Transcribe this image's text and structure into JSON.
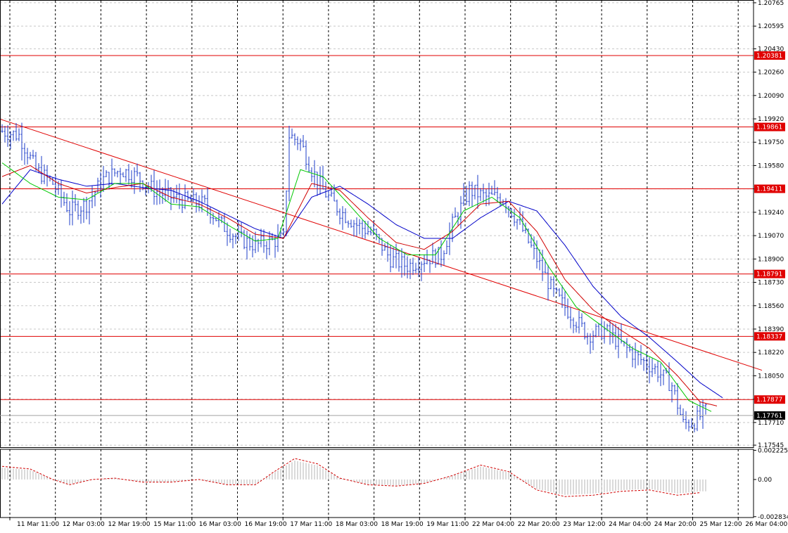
{
  "chart_data": {
    "type": "line",
    "symbol": "",
    "price_axis": {
      "ylim": [
        1.1753,
        1.2078
      ],
      "ticks": [
        "1.20765",
        "1.20595",
        "1.20430",
        "1.20260",
        "1.20090",
        "1.19920",
        "1.19750",
        "1.19580",
        "1.19410",
        "1.19240",
        "1.19070",
        "1.18900",
        "1.18730",
        "1.18560",
        "1.18390",
        "1.18220",
        "1.18050",
        "1.17880",
        "1.17710",
        "1.17545"
      ]
    },
    "oscillator_axis": {
      "ylim": [
        -0.0029,
        0.0023
      ],
      "ticks": [
        "0.002225",
        "0.00",
        "-0.002834"
      ]
    },
    "time_axis": {
      "labels": [
        "11 Mar 11:00",
        "12 Mar 03:00",
        "12 Mar 19:00",
        "15 Mar 11:00",
        "16 Mar 03:00",
        "16 Mar 19:00",
        "17 Mar 11:00",
        "18 Mar 03:00",
        "18 Mar 19:00",
        "19 Mar 11:00",
        "22 Mar 04:00",
        "22 Mar 20:00",
        "23 Mar 12:00",
        "24 Mar 04:00",
        "24 Mar 20:00",
        "25 Mar 12:00",
        "26 Mar 04:00"
      ]
    },
    "horizontal_levels": [
      {
        "label": "1.20381",
        "value": 1.20381,
        "color": "#e00000"
      },
      {
        "label": "1.19861",
        "value": 1.19861,
        "color": "#e00000"
      },
      {
        "label": "1.19411",
        "value": 1.19411,
        "color": "#e00000"
      },
      {
        "label": "1.18791",
        "value": 1.18791,
        "color": "#e00000"
      },
      {
        "label": "1.18337",
        "value": 1.18337,
        "color": "#e00000"
      },
      {
        "label": "1.17877",
        "value": 1.17877,
        "color": "#e00000"
      }
    ],
    "current_price": {
      "label": "1.17761",
      "value": 1.17761,
      "color": "#000000"
    },
    "trendline": {
      "from": [
        -4,
        1.1994
      ],
      "to": [
        270,
        1.1809
      ],
      "color": "#e00000"
    },
    "price_series": [
      [
        0,
        1.1983
      ],
      [
        6,
        1.198
      ],
      [
        12,
        1.1955
      ],
      [
        18,
        1.1945
      ],
      [
        24,
        1.1925
      ],
      [
        30,
        1.193
      ],
      [
        36,
        1.1948
      ],
      [
        42,
        1.1955
      ],
      [
        48,
        1.195
      ],
      [
        54,
        1.194
      ],
      [
        60,
        1.1935
      ],
      [
        66,
        1.1932
      ],
      [
        72,
        1.193
      ],
      [
        78,
        1.1915
      ],
      [
        84,
        1.1905
      ],
      [
        90,
        1.19
      ],
      [
        96,
        1.1903
      ],
      [
        100,
        1.1905
      ],
      [
        102,
        1.198
      ],
      [
        106,
        1.1975
      ],
      [
        110,
        1.1955
      ],
      [
        114,
        1.194
      ],
      [
        120,
        1.1925
      ],
      [
        126,
        1.1915
      ],
      [
        132,
        1.1908
      ],
      [
        138,
        1.189
      ],
      [
        144,
        1.1885
      ],
      [
        150,
        1.189
      ],
      [
        156,
        1.1893
      ],
      [
        160,
        1.1915
      ],
      [
        166,
        1.194
      ],
      [
        172,
        1.1935
      ],
      [
        178,
        1.1935
      ],
      [
        184,
        1.1915
      ],
      [
        190,
        1.189
      ],
      [
        196,
        1.1865
      ],
      [
        202,
        1.185
      ],
      [
        208,
        1.1835
      ],
      [
        214,
        1.1838
      ],
      [
        220,
        1.1828
      ],
      [
        226,
        1.1818
      ],
      [
        232,
        1.181
      ],
      [
        238,
        1.1798
      ],
      [
        242,
        1.177
      ],
      [
        246,
        1.1772
      ],
      [
        250,
        1.1779
      ]
    ],
    "ma_fast": [
      [
        0,
        1.196
      ],
      [
        10,
        1.1945
      ],
      [
        20,
        1.1935
      ],
      [
        30,
        1.1933
      ],
      [
        40,
        1.1945
      ],
      [
        50,
        1.1945
      ],
      [
        60,
        1.193
      ],
      [
        70,
        1.1928
      ],
      [
        80,
        1.1915
      ],
      [
        90,
        1.1903
      ],
      [
        98,
        1.1905
      ],
      [
        106,
        1.1955
      ],
      [
        114,
        1.195
      ],
      [
        124,
        1.1928
      ],
      [
        134,
        1.1905
      ],
      [
        144,
        1.1893
      ],
      [
        154,
        1.1893
      ],
      [
        164,
        1.1925
      ],
      [
        174,
        1.1935
      ],
      [
        184,
        1.192
      ],
      [
        194,
        1.1885
      ],
      [
        204,
        1.1855
      ],
      [
        214,
        1.184
      ],
      [
        224,
        1.1825
      ],
      [
        234,
        1.1815
      ],
      [
        244,
        1.1787
      ],
      [
        252,
        1.1779
      ]
    ],
    "ma_mid": [
      [
        0,
        1.195
      ],
      [
        10,
        1.1958
      ],
      [
        20,
        1.1945
      ],
      [
        30,
        1.1938
      ],
      [
        40,
        1.1942
      ],
      [
        50,
        1.1945
      ],
      [
        60,
        1.1935
      ],
      [
        70,
        1.193
      ],
      [
        80,
        1.192
      ],
      [
        90,
        1.1908
      ],
      [
        100,
        1.1905
      ],
      [
        110,
        1.1945
      ],
      [
        120,
        1.194
      ],
      [
        130,
        1.192
      ],
      [
        140,
        1.1902
      ],
      [
        150,
        1.1897
      ],
      [
        160,
        1.191
      ],
      [
        170,
        1.193
      ],
      [
        180,
        1.1932
      ],
      [
        190,
        1.191
      ],
      [
        200,
        1.1875
      ],
      [
        210,
        1.1853
      ],
      [
        220,
        1.1838
      ],
      [
        230,
        1.1825
      ],
      [
        240,
        1.1805
      ],
      [
        248,
        1.1786
      ],
      [
        254,
        1.1783
      ]
    ],
    "ma_slow": [
      [
        0,
        1.193
      ],
      [
        10,
        1.1955
      ],
      [
        20,
        1.1948
      ],
      [
        30,
        1.1943
      ],
      [
        40,
        1.1945
      ],
      [
        50,
        1.1942
      ],
      [
        60,
        1.194
      ],
      [
        70,
        1.1932
      ],
      [
        80,
        1.1922
      ],
      [
        90,
        1.1912
      ],
      [
        100,
        1.1905
      ],
      [
        110,
        1.1935
      ],
      [
        120,
        1.1943
      ],
      [
        130,
        1.193
      ],
      [
        140,
        1.1915
      ],
      [
        150,
        1.1905
      ],
      [
        160,
        1.1905
      ],
      [
        170,
        1.192
      ],
      [
        180,
        1.1932
      ],
      [
        190,
        1.1925
      ],
      [
        200,
        1.19
      ],
      [
        210,
        1.187
      ],
      [
        220,
        1.1848
      ],
      [
        230,
        1.1833
      ],
      [
        240,
        1.1815
      ],
      [
        248,
        1.18
      ],
      [
        256,
        1.1789
      ]
    ],
    "osc_histogram_range": [
      0,
      250
    ],
    "osc_signal": [
      [
        0,
        0.001
      ],
      [
        10,
        0.0008
      ],
      [
        18,
        0.0
      ],
      [
        24,
        -0.0004
      ],
      [
        32,
        0.0
      ],
      [
        40,
        0.0001
      ],
      [
        50,
        -0.0002
      ],
      [
        60,
        -0.0002
      ],
      [
        70,
        0.0
      ],
      [
        80,
        -0.0004
      ],
      [
        90,
        -0.0004
      ],
      [
        96,
        0.0005
      ],
      [
        104,
        0.0016
      ],
      [
        112,
        0.0012
      ],
      [
        120,
        0.0001
      ],
      [
        130,
        -0.0004
      ],
      [
        140,
        -0.0005
      ],
      [
        150,
        -0.0003
      ],
      [
        160,
        0.0003
      ],
      [
        170,
        0.0011
      ],
      [
        180,
        0.0006
      ],
      [
        190,
        -0.0008
      ],
      [
        200,
        -0.0013
      ],
      [
        210,
        -0.0012
      ],
      [
        220,
        -0.0009
      ],
      [
        230,
        -0.0008
      ],
      [
        240,
        -0.0012
      ],
      [
        248,
        -0.001
      ]
    ]
  }
}
